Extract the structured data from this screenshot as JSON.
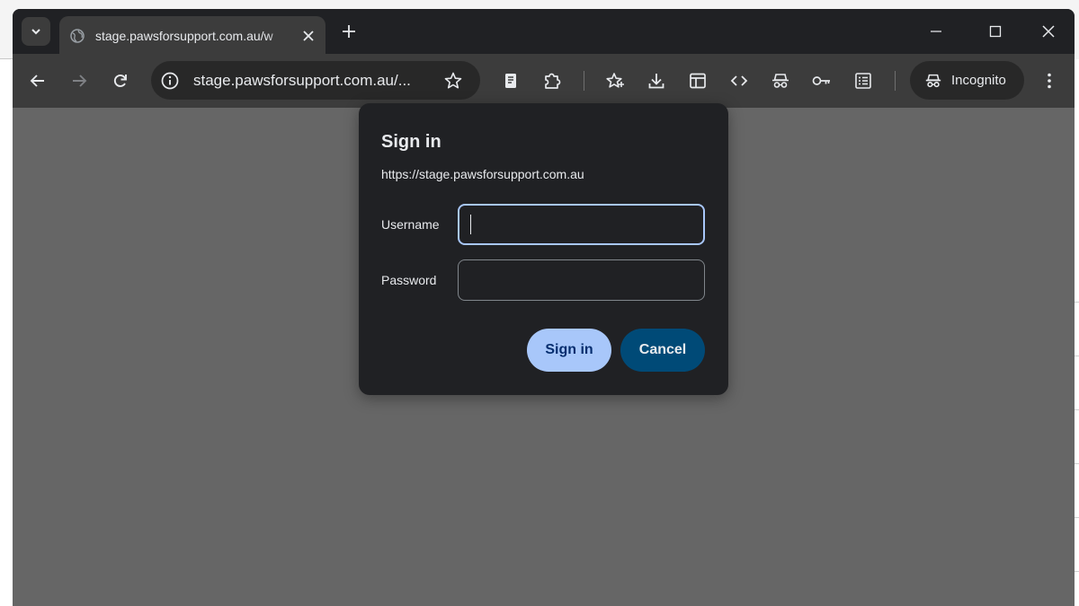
{
  "browser": {
    "tab": {
      "title": "stage.pawsforsupport.com.au/w"
    },
    "omnibox": {
      "url": "stage.pawsforsupport.com.au/..."
    },
    "profile": {
      "label": "Incognito"
    }
  },
  "dialog": {
    "title": "Sign in",
    "origin": "https://stage.pawsforsupport.com.au",
    "username_label": "Username",
    "username_value": "",
    "password_label": "Password",
    "password_value": "",
    "signin_label": "Sign in",
    "cancel_label": "Cancel"
  },
  "colors": {
    "chrome_dark": "#202124",
    "toolbar": "#3c3c3c",
    "page_scrim": "#666666",
    "primary_button": "#a8c7fa",
    "cancel_button": "#004a77"
  },
  "icons": [
    "tab-search-icon",
    "globe-icon",
    "close-icon",
    "plus-icon",
    "minimize-icon",
    "maximize-icon",
    "back-icon",
    "forward-icon",
    "reload-icon",
    "info-icon",
    "star-icon",
    "reading-mode-icon",
    "extensions-icon",
    "bookmarks-icon",
    "download-icon",
    "side-panel-icon",
    "devtools-icon",
    "incognito-icon",
    "key-icon",
    "reading-list-icon",
    "more-icon"
  ]
}
